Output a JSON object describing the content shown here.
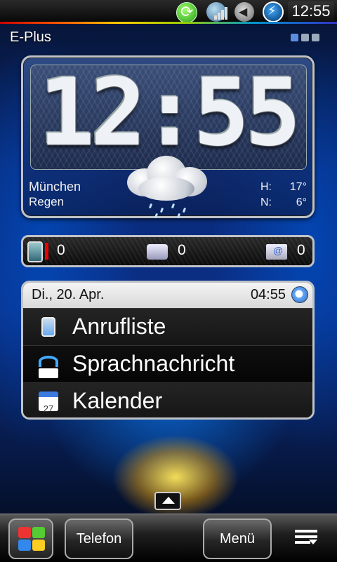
{
  "status_bar": {
    "time": "12:55",
    "icons": [
      "sync-icon",
      "globe-signal-icon",
      "sound-icon",
      "lightning-icon"
    ]
  },
  "carrier": "E-Plus",
  "pager": {
    "pages": 3,
    "active_index": 0
  },
  "clock_widget": {
    "time": "12:55",
    "city": "München",
    "condition": "Regen",
    "high_label": "H:",
    "high_value": "17°",
    "low_label": "N:",
    "low_value": "6°",
    "weather_icon": "rain-cloud-icon"
  },
  "notifications": [
    {
      "icon": "missed-call-icon",
      "count": "0"
    },
    {
      "icon": "sms-icon",
      "count": "0"
    },
    {
      "icon": "email-icon",
      "count": "0"
    }
  ],
  "agenda": {
    "date": "Di., 20. Apr.",
    "alarm_time": "04:55",
    "items": [
      {
        "label": "Anrufliste",
        "icon": "phone-icon"
      },
      {
        "label": "Sprachnachricht",
        "icon": "voicemail-icon"
      },
      {
        "label": "Kalender",
        "icon": "calendar-icon",
        "icon_text": "27"
      }
    ]
  },
  "dock": {
    "left_button": "Telefon",
    "right_button": "Menü"
  },
  "colors": {
    "accent_blue": "#3a7be0",
    "missed_red": "#e00000",
    "widget_border": "#bfc3c8"
  }
}
